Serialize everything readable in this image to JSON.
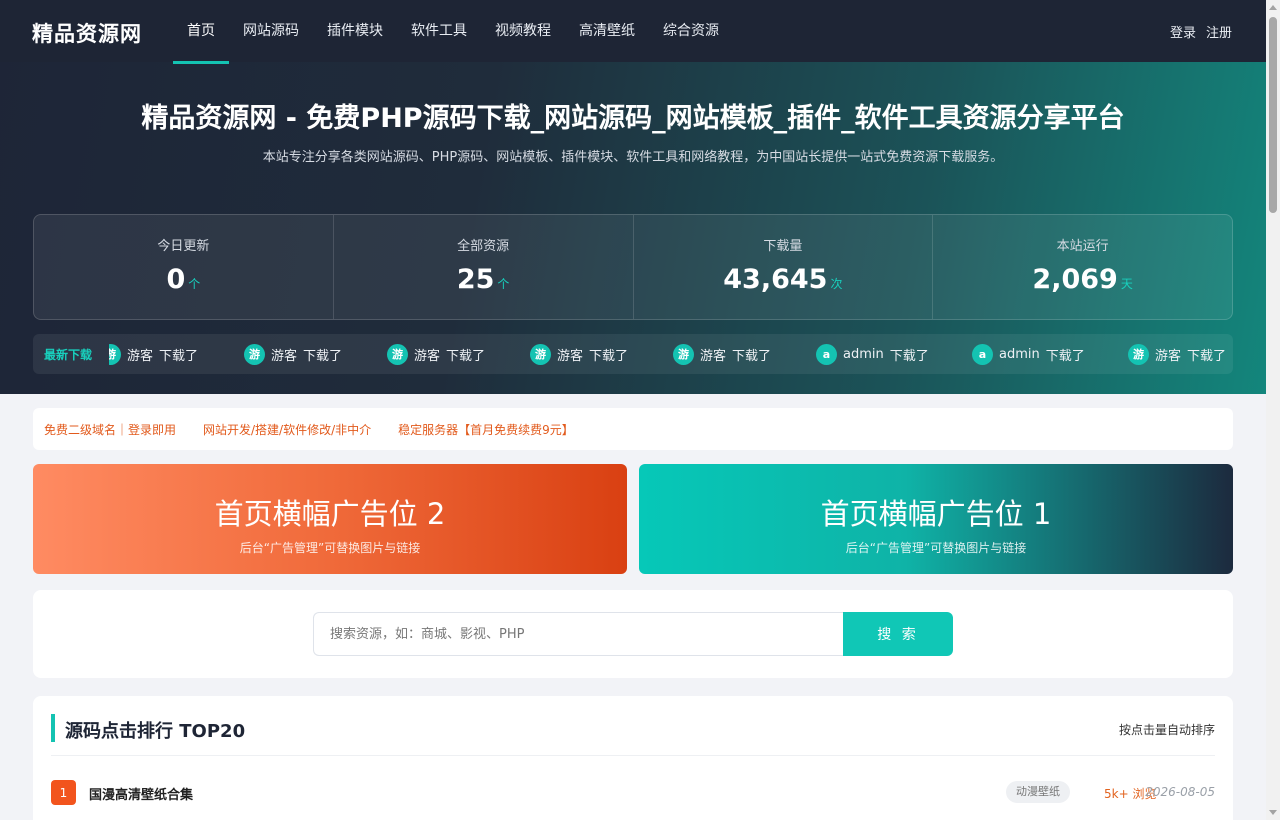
{
  "site": {
    "logo": "精品资源网"
  },
  "nav": {
    "items": [
      "首页",
      "网站源码",
      "插件模块",
      "软件工具",
      "视频教程",
      "高清壁纸",
      "综合资源"
    ],
    "login": "登录",
    "register": "注册"
  },
  "hero": {
    "title": "精品资源网 - 免费PHP源码下载_网站源码_网站模板_插件_软件工具资源分享平台",
    "subtitle": "本站专注分享各类网站源码、PHP源码、网站模板、插件模块、软件工具和网络教程，为中国站长提供一站式免费资源下载服务。"
  },
  "stats": [
    {
      "label": "今日更新",
      "value": "0",
      "unit": "个"
    },
    {
      "label": "全部资源",
      "value": "25",
      "unit": "个"
    },
    {
      "label": "下载量",
      "value": "43,645",
      "unit": "次"
    },
    {
      "label": "本站运行",
      "value": "2,069",
      "unit": "天"
    }
  ],
  "ticker": {
    "label": "最新下载",
    "items": [
      {
        "avatar": "游",
        "user": "游客",
        "action": "下载了"
      },
      {
        "avatar": "游",
        "user": "游客",
        "action": "下载了"
      },
      {
        "avatar": "游",
        "user": "游客",
        "action": "下载了"
      },
      {
        "avatar": "游",
        "user": "游客",
        "action": "下载了"
      },
      {
        "avatar": "游",
        "user": "游客",
        "action": "下载了"
      },
      {
        "avatar": "a",
        "user": "admin",
        "action": "下载了"
      },
      {
        "avatar": "a",
        "user": "admin",
        "action": "下载了"
      },
      {
        "avatar": "游",
        "user": "游客",
        "action": "下载了"
      }
    ]
  },
  "links": [
    "免费二级域名｜登录即用",
    "网站开发/搭建/软件修改/非中介",
    "稳定服务器【首月免费续费9元】"
  ],
  "banners": [
    {
      "title": "首页横幅广告位 2",
      "subtitle": "后台“广告管理”可替换图片与链接"
    },
    {
      "title": "首页横幅广告位 1",
      "subtitle": "后台“广告管理”可替换图片与链接"
    }
  ],
  "search": {
    "placeholder": "搜索资源，如：商城、影视、PHP",
    "button": "搜 索"
  },
  "ranking": {
    "title": "源码点击排行 TOP20",
    "note": "按点击量自动排序",
    "rows": [
      {
        "rank": "1",
        "name": "国漫高清壁纸合集",
        "tag": "动漫壁纸",
        "views": "5k+ 浏览",
        "date": "2026-08-05"
      }
    ]
  },
  "colors": {
    "accent": "#14c3b2",
    "rank": "#f2541d",
    "link": "#e25a1c",
    "nav": "#1e2535"
  }
}
